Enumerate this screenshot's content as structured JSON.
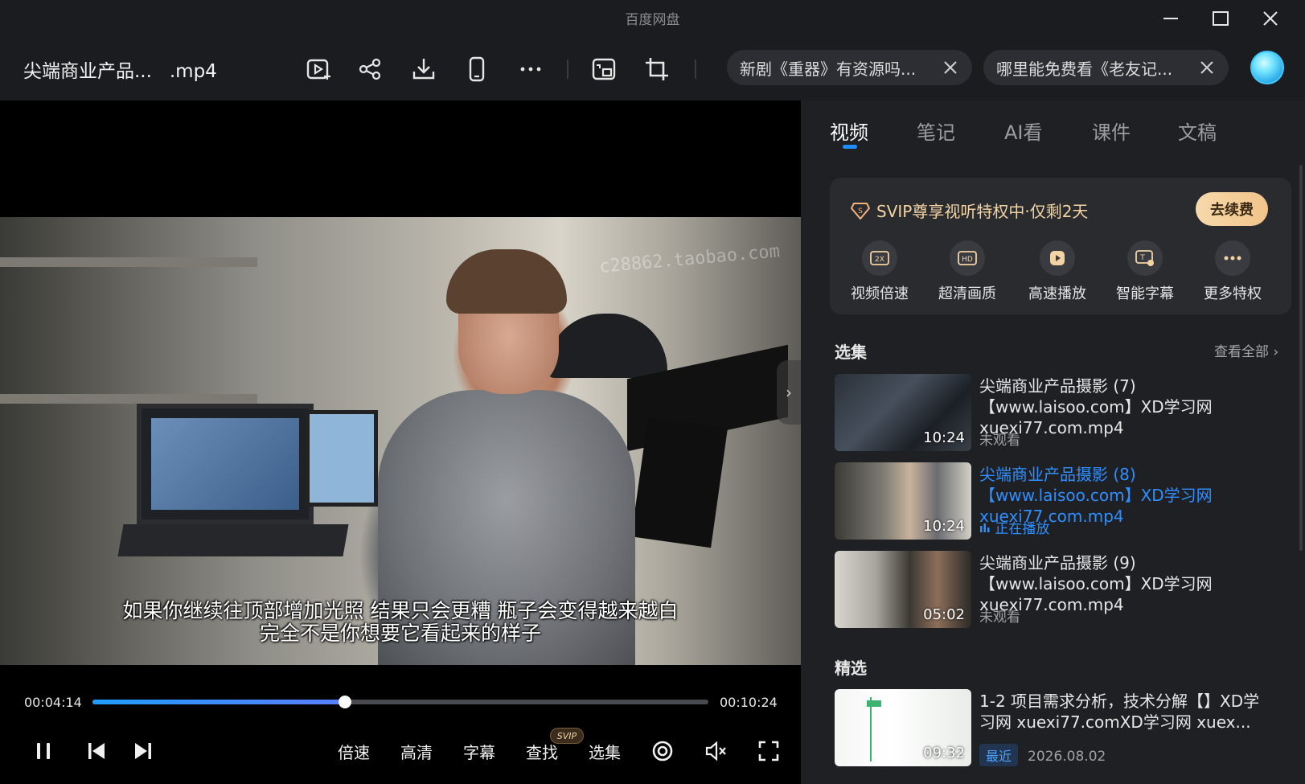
{
  "app": {
    "title": "百度网盘"
  },
  "header": {
    "file_title": "尖端商业产品...   .mp4",
    "tools": [
      "play-to-tv-icon",
      "share-icon",
      "download-icon",
      "phone-icon",
      "more-icon",
      "screenshot-icon",
      "crop-icon"
    ],
    "search_pills": [
      {
        "text": "新剧《重器》有资源吗..."
      },
      {
        "text": "哪里能免费看《老友记..."
      }
    ]
  },
  "player": {
    "subtitle_line1": "如果你继续往顶部增加光照  结果只会更糟  瓶子会变得越来越白",
    "subtitle_line2": "完全不是你想要它看起来的样子",
    "watermark": "c28862.taobao.com",
    "current_time": "00:04:14",
    "total_time": "00:10:24",
    "progress": 0.41,
    "controls": {
      "speed": "倍速",
      "quality": "高清",
      "subtitle": "字幕",
      "find": "查找",
      "find_badge": "SVIP",
      "episodes": "选集"
    }
  },
  "panel": {
    "tabs": [
      "视频",
      "笔记",
      "AI看",
      "课件",
      "文稿"
    ],
    "active_tab": 0,
    "svip": {
      "title": "SVIP尊享视听特权中·仅剩2天",
      "renew": "去续费",
      "perks": [
        {
          "label": "视频倍速",
          "icon": "speed-2x-icon"
        },
        {
          "label": "超清画质",
          "icon": "hd-icon"
        },
        {
          "label": "高速播放",
          "icon": "fast-play-icon"
        },
        {
          "label": "智能字幕",
          "icon": "smart-subtitle-icon"
        },
        {
          "label": "更多特权",
          "icon": "more-perks-icon"
        }
      ]
    },
    "episodes_title": "选集",
    "view_all": "查看全部",
    "episodes": [
      {
        "title": "尖端商业产品摄影 (7)【www.laisoo.com】XD学习网 xuexi77.com.mp4",
        "duration": "10:24",
        "status": "未观看",
        "playing": false
      },
      {
        "title": "尖端商业产品摄影 (8)【www.laisoo.com】XD学习网 xuexi77.com.mp4",
        "duration": "10:24",
        "status": "正在播放",
        "playing": true
      },
      {
        "title": "尖端商业产品摄影 (9)【www.laisoo.com】XD学习网 xuexi77.com.mp4",
        "duration": "05:02",
        "status": "未观看",
        "playing": false
      }
    ],
    "featured_title": "精选",
    "featured": {
      "title": "1-2 项目需求分析，技术分解【】XD学习网 xuexi77.comXD学习网 xuex...",
      "duration": "09:32",
      "badge": "最近",
      "date": "2026.08.02"
    }
  },
  "colors": {
    "accent": "#1e8dff",
    "playing": "#2f8fff",
    "svip_gold": "#f2d3a3"
  }
}
